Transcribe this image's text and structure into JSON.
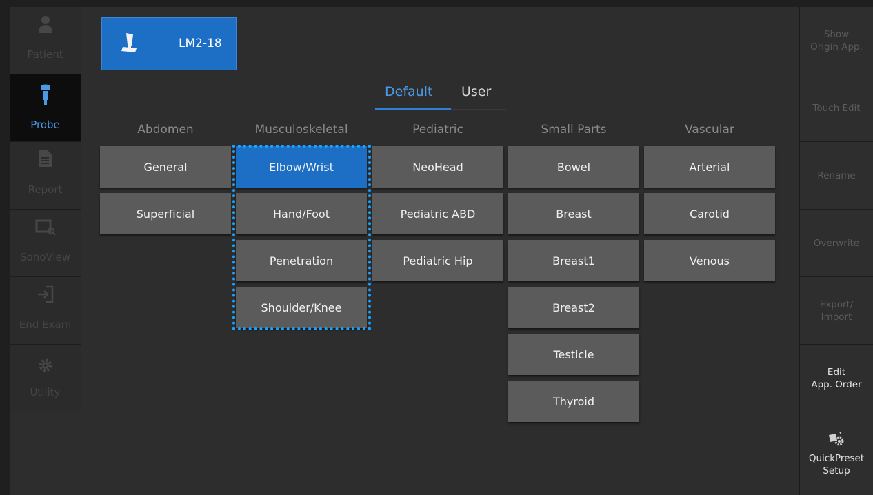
{
  "sidebar": {
    "items": [
      {
        "label": "Patient",
        "icon": "person-icon",
        "active": false
      },
      {
        "label": "Probe",
        "icon": "probe-icon",
        "active": true
      },
      {
        "label": "Report",
        "icon": "document-icon",
        "active": false
      },
      {
        "label": "SonoView",
        "icon": "sonoview-icon",
        "active": false
      },
      {
        "label": "End Exam",
        "icon": "exit-icon",
        "active": false
      },
      {
        "label": "Utility",
        "icon": "gear-icon",
        "active": false
      }
    ]
  },
  "probe": {
    "label": "LM2-18",
    "icon": "transducer-icon"
  },
  "tabs": {
    "default": "Default",
    "user": "User",
    "active": "Default"
  },
  "categories": [
    {
      "name": "Abdomen",
      "presets": [
        "General",
        "Superficial"
      ]
    },
    {
      "name": "Musculoskeletal",
      "presets": [
        "Elbow/Wrist",
        "Hand/Foot",
        "Penetration",
        "Shoulder/Knee"
      ]
    },
    {
      "name": "Pediatric",
      "presets": [
        "NeoHead",
        "Pediatric ABD",
        "Pediatric Hip"
      ]
    },
    {
      "name": "Small Parts",
      "presets": [
        "Bowel",
        "Breast",
        "Breast1",
        "Breast2",
        "Testicle",
        "Thyroid"
      ]
    },
    {
      "name": "Vascular",
      "presets": [
        "Arterial",
        "Carotid",
        "Venous"
      ]
    }
  ],
  "selected_preset": "Elbow/Wrist",
  "right_panel": {
    "show_origin_app": [
      "Show",
      "Origin App."
    ],
    "touch_edit": "Touch Edit",
    "rename": "Rename",
    "overwrite": "Overwrite",
    "export_import": [
      "Export/",
      "Import"
    ],
    "edit_app_order": [
      "Edit",
      "App. Order"
    ],
    "quickpreset_setup": [
      "QuickPreset",
      "Setup"
    ]
  },
  "colors": {
    "accent": "#1d6fc6",
    "highlight_dashed": "#1aa3ff",
    "button": "#5b5b5b"
  }
}
